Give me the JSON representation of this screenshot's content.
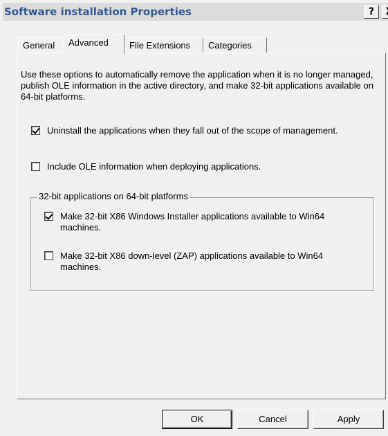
{
  "window": {
    "title": "Software installation Properties",
    "help_button": "?",
    "close_button": "X"
  },
  "tabs": [
    {
      "label": "General",
      "active": false
    },
    {
      "label": "Advanced",
      "active": true
    },
    {
      "label": "File Extensions",
      "active": false
    },
    {
      "label": "Categories",
      "active": false
    }
  ],
  "content": {
    "description": "Use these options to automatically remove the application when it is no longer managed, publish OLE information in the active directory, and make 32-bit applications available on 64-bit platforms.",
    "uninstall": {
      "label": "Uninstall the applications when they fall out of the scope of management.",
      "checked": true
    },
    "include_ole": {
      "label": "Include OLE information when deploying applications.",
      "checked": false
    },
    "group": {
      "legend": "32-bit applications on 64-bit platforms",
      "make_x86_installer": {
        "label": "Make 32-bit X86 Windows Installer applications available to Win64 machines.",
        "checked": true
      },
      "make_x86_zap": {
        "label": "Make 32-bit X86 down-level (ZAP) applications available to Win64 machines.",
        "checked": false
      }
    }
  },
  "buttons": {
    "ok": "OK",
    "cancel": "Cancel",
    "apply": "Apply"
  }
}
